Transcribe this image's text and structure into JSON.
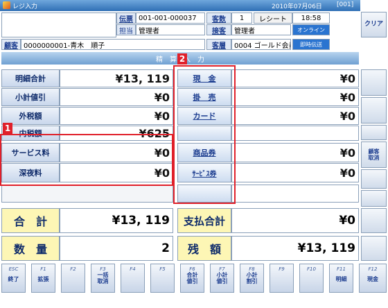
{
  "titlebar": {
    "title": "レジ入力",
    "date": "2010年07月06日",
    "code": "[001]"
  },
  "header": {
    "slip_label": "伝票",
    "slip_value": "001-001-000037",
    "guest_label": "客数",
    "guest_value": "1",
    "receipt_label": "レシート",
    "time": "18:58",
    "clear_label": "クリア",
    "staff_label": "担当",
    "staff_value": "管理者",
    "server_label": "接客",
    "server_value": "管理者",
    "online_label": "オンライン",
    "customer_label": "顧客",
    "customer_value": "0000000001-青木　順子",
    "cust_type_label": "客層",
    "cust_type_value": "0004 ゴールド会員",
    "instant_label": "即時伝送"
  },
  "section_title": "精　算　入　力",
  "left_rows": [
    {
      "label": "明細合計",
      "value": "¥13, 119"
    },
    {
      "label": "小計値引",
      "value": "¥0"
    },
    {
      "label": "外税額",
      "value": "¥0"
    },
    {
      "label": "内税額",
      "value": "¥625"
    },
    {
      "label": "サービス料",
      "value": "¥0"
    },
    {
      "label": "深夜料",
      "value": "¥0"
    }
  ],
  "payments": [
    {
      "label": "現　金",
      "value": "¥0"
    },
    {
      "label": "掛　売",
      "value": "¥0"
    },
    {
      "label": "カード",
      "value": "¥0"
    },
    {
      "label": "",
      "value": ""
    },
    {
      "label": "商品券",
      "value": "¥0"
    },
    {
      "label": "ｻｰﾋﾞｽ券",
      "value": "¥0"
    },
    {
      "label": "",
      "value": ""
    }
  ],
  "totals": {
    "total_label": "合　計",
    "total_value": "¥13, 119",
    "pay_total_label": "支払合計",
    "pay_total_value": "¥0",
    "qty_label": "数　量",
    "qty_value": "2",
    "balance_label": "残　額",
    "balance_value": "¥13, 119"
  },
  "side_buttons": {
    "customer_cancel": "顧客\n取消"
  },
  "fkeys": [
    {
      "key": "ESC",
      "label": "終了"
    },
    {
      "key": "F1",
      "label": "拡張"
    },
    {
      "key": "F2",
      "label": ""
    },
    {
      "key": "F3",
      "label": "一括\n取消"
    },
    {
      "key": "F4",
      "label": ""
    },
    {
      "key": "F5",
      "label": ""
    },
    {
      "key": "F6",
      "label": "合計\n値引"
    },
    {
      "key": "F7",
      "label": "小計\n値引"
    },
    {
      "key": "F8",
      "label": "小計\n割引"
    },
    {
      "key": "F9",
      "label": ""
    },
    {
      "key": "F10",
      "label": ""
    },
    {
      "key": "F11",
      "label": "明細"
    },
    {
      "key": "F12",
      "label": "現金"
    }
  ],
  "callouts": {
    "one": "1",
    "two": "2"
  }
}
